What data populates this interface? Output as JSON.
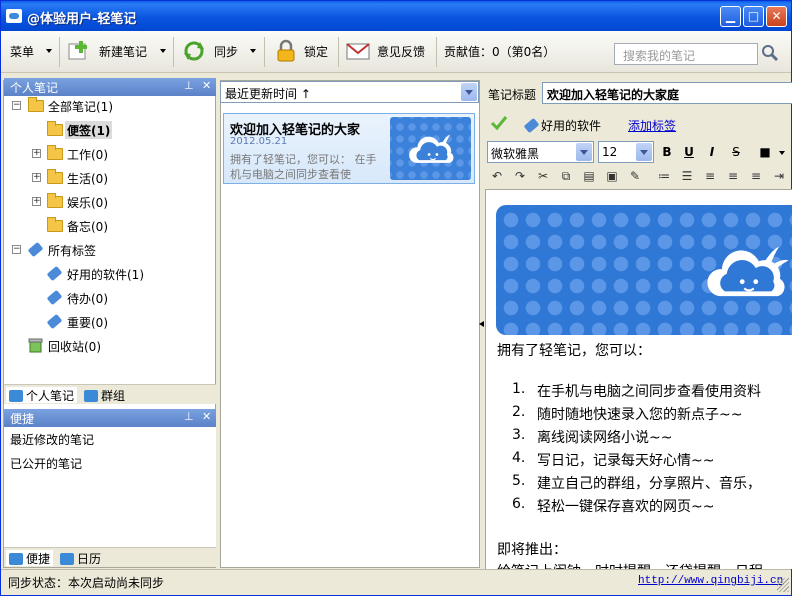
{
  "window": {
    "title": "@体验用户-轻笔记"
  },
  "toolbar": {
    "menu_label": "菜单",
    "new_note_label": "新建笔记",
    "sync_label": "同步",
    "lock_label": "锁定",
    "feedback_label": "意见反馈",
    "contribution_label": "贡献值：0（第0名）",
    "search_placeholder": "搜索我的笔记"
  },
  "left_panel": {
    "title": "个人笔记",
    "tree": {
      "all_notes": "全部笔记(1)",
      "folders": [
        "便签(1)",
        "工作(0)",
        "生活(0)",
        "娱乐(0)",
        "备忘(0)"
      ],
      "all_tags": "所有标签",
      "tags": [
        "好用的软件(1)",
        "待办(0)",
        "重要(0)"
      ],
      "recycle": "回收站(0)"
    },
    "tabs": [
      "个人笔记",
      "群组"
    ]
  },
  "quick_panel": {
    "title": "便捷",
    "items": [
      "最近修改的笔记",
      "已公开的笔记"
    ],
    "tabs": [
      "便捷",
      "日历"
    ]
  },
  "note_list": {
    "sort_value": "最近更新时间 ↑",
    "notes": [
      {
        "title": "欢迎加入轻笔记的大家",
        "date": "2012.05.21",
        "preview": "拥有了轻笔记，您可以： 在手机与电脑之间同步查看使"
      }
    ]
  },
  "editor": {
    "title_label": "笔记标题",
    "title_value": "欢迎加入轻笔记的大家庭",
    "tag": "好用的软件",
    "add_tag_link": "添加标签",
    "font": "微软雅黑",
    "size": "12",
    "intro": "拥有了轻笔记，您可以：",
    "list": [
      "在手机与电脑之间同步查看使用资料",
      "随时随地快速录入您的新点子~~",
      "离线阅读网络小说~~",
      "写日记，记录每天好心情~~",
      "建立自己的群组，分享照片、音乐，",
      "轻松一键保存喜欢的网页~~"
    ],
    "coming": "即将推出：",
    "coming_partial": "给笔记上闹钟，时时提醒，还贷提醒，日程"
  },
  "status": {
    "sync_status": "同步状态：本次启动尚未同步",
    "url": "http://www.qingbiji.cn"
  },
  "colors": {
    "title_bar": "#0a55e0",
    "link": "#0000cc",
    "banner": "#2f78d6"
  }
}
